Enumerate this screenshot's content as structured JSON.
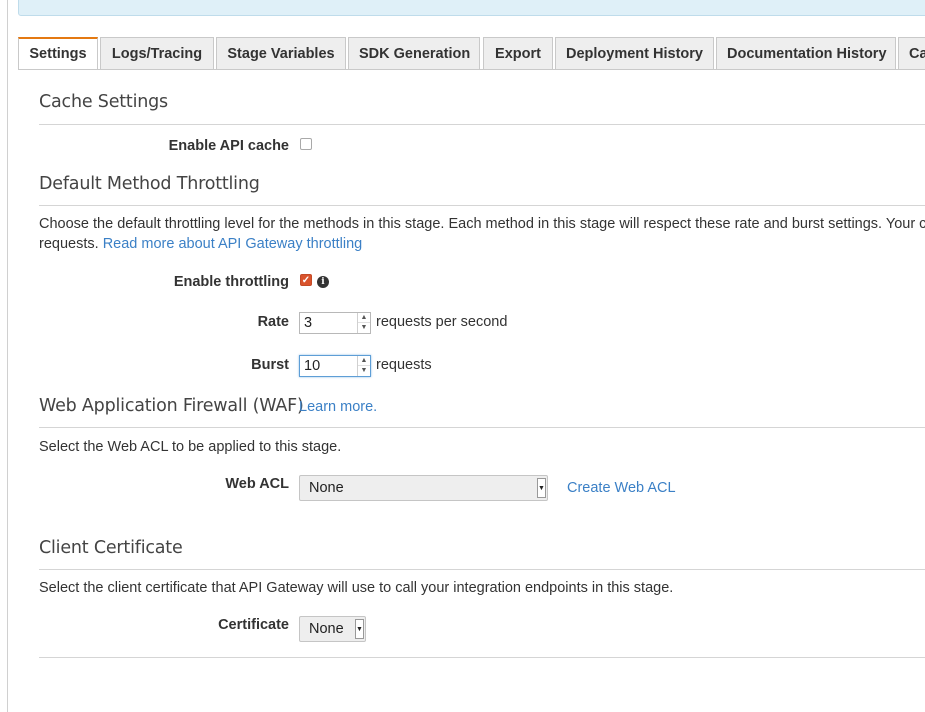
{
  "tabs": [
    {
      "label": "Settings"
    },
    {
      "label": "Logs/Tracing"
    },
    {
      "label": "Stage Variables"
    },
    {
      "label": "SDK Generation"
    },
    {
      "label": "Export"
    },
    {
      "label": "Deployment History"
    },
    {
      "label": "Documentation History"
    },
    {
      "label": "Ca"
    }
  ],
  "cache": {
    "title": "Cache Settings",
    "enable_label": "Enable API cache",
    "enabled": false
  },
  "throttling": {
    "title": "Default Method Throttling",
    "description_line1": "Choose the default throttling level for the methods in this stage. Each method in this stage will respect these rate and burst settings. Your curren",
    "description_line2": "requests.",
    "link": "Read more about API Gateway throttling",
    "enable_label": "Enable throttling",
    "enabled": true,
    "rate_label": "Rate",
    "rate_value": "3",
    "rate_unit": "requests per second",
    "burst_label": "Burst",
    "burst_value": "10",
    "burst_unit": "requests"
  },
  "waf": {
    "title": "Web Application Firewall (WAF)",
    "learn_more": "Learn more.",
    "description": "Select the Web ACL to be applied to this stage.",
    "acl_label": "Web ACL",
    "acl_value": "None",
    "create_link": "Create Web ACL"
  },
  "certificate": {
    "title": "Client Certificate",
    "description": "Select the client certificate that API Gateway will use to call your integration endpoints in this stage.",
    "label": "Certificate",
    "value": "None"
  },
  "colors": {
    "accent_tab": "#e47911",
    "link": "#3b80c6",
    "checkbox_checked": "#d9532c",
    "banner": "#dff0f8"
  }
}
